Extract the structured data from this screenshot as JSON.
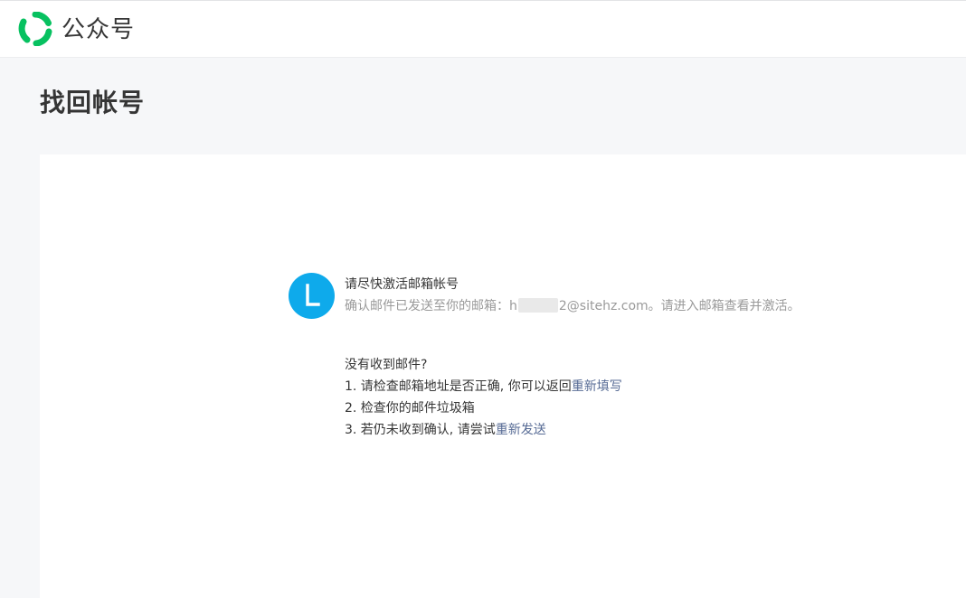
{
  "header": {
    "brand": "公众号"
  },
  "page": {
    "title": "找回帐号"
  },
  "message": {
    "avatar_letter": "L",
    "title": "请尽快激活邮箱帐号",
    "desc_prefix": "确认邮件已发送至你的邮箱：",
    "email_start": "h",
    "email_end": "2@sitehz.com",
    "desc_suffix": "。请进入邮箱查看并激活。"
  },
  "help": {
    "heading": "没有收到邮件?",
    "item1_text": "1. 请检查邮箱地址是否正确, 你可以返回",
    "item1_link": "重新填写",
    "item2_text": "2. 检查你的邮件垃圾箱",
    "item3_text": "3. 若仍未收到确认, 请尝试",
    "item3_link": "重新发送"
  },
  "colors": {
    "brand_green": "#07c160",
    "avatar_blue": "#0eaaeb",
    "link": "#576b95"
  }
}
